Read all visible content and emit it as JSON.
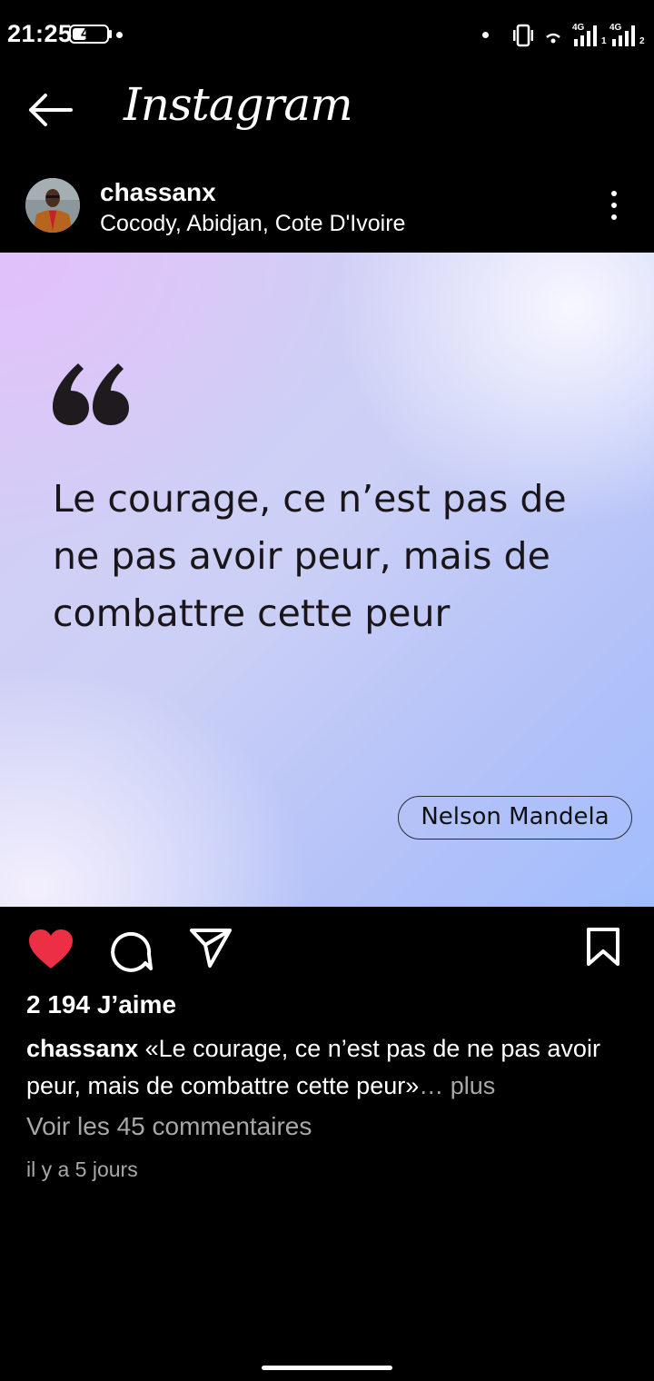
{
  "status_bar": {
    "time": "21:25",
    "battery": "43",
    "battery_level": 0.43,
    "network_1": "4G",
    "network_2": "4G",
    "sim_1": "1",
    "sim_2": "2"
  },
  "app_bar": {
    "title": "Instagram"
  },
  "post": {
    "username": "chassanx",
    "location": "Cocody, Abidjan, Cote D'Ivoire",
    "image": {
      "quote": "Le courage, ce n’est pas de ne pas avoir peur, mais de combattre cette peur",
      "author": "Nelson Mandela"
    },
    "likes": "2 194 J’aime",
    "caption_username": "chassanx",
    "caption_text": "«Le courage, ce n’est pas de ne pas avoir peur, mais de combattre cette peur»",
    "caption_more": "… plus",
    "view_comments": "Voir les 45 commentaires",
    "time_ago": "il y a 5 jours",
    "liked": true
  },
  "colors": {
    "background": "#000000",
    "like_red": "#ed2f45",
    "secondary_text": "#a8a8a8"
  },
  "icons": [
    "back-arrow-icon",
    "more-options-icon",
    "heart-icon",
    "comment-icon",
    "share-icon",
    "bookmark-icon",
    "quote-icon"
  ]
}
